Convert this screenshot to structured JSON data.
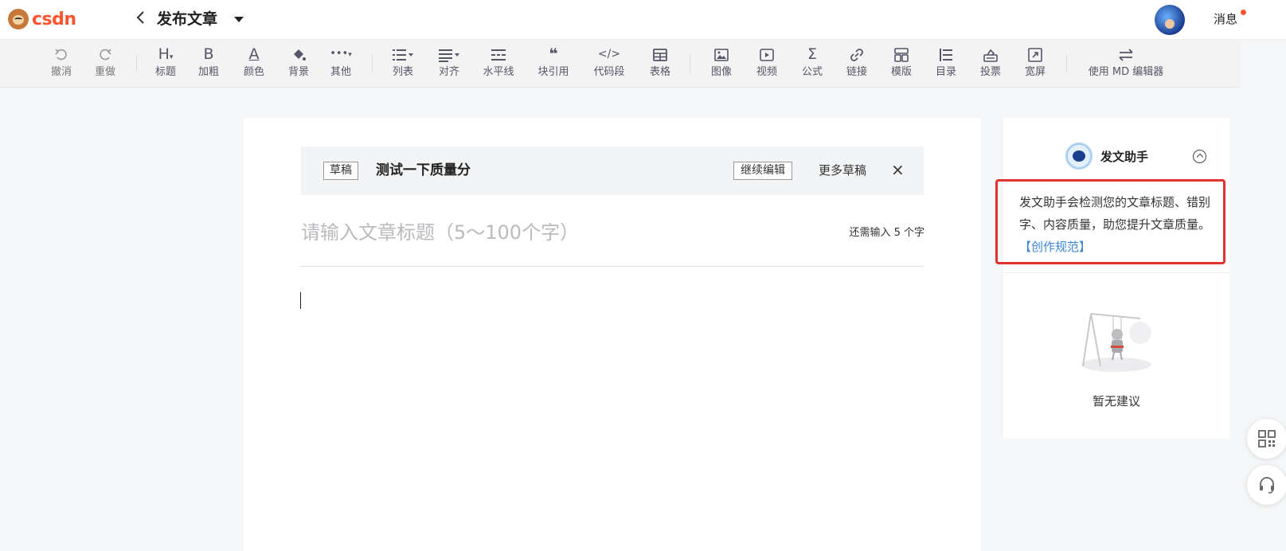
{
  "header": {
    "logo_text": "csdn",
    "back_label": "<",
    "page_title": "发布文章",
    "messages_label": "消息"
  },
  "toolbar": {
    "items": [
      {
        "label": "撤消",
        "icon": "undo-icon"
      },
      {
        "label": "重做",
        "icon": "redo-icon"
      },
      {
        "label": "标题",
        "icon": "heading-icon"
      },
      {
        "label": "加粗",
        "icon": "bold-icon"
      },
      {
        "label": "颜色",
        "icon": "font-color-icon"
      },
      {
        "label": "背景",
        "icon": "paint-bucket-icon"
      },
      {
        "label": "其他",
        "icon": "more-icon"
      },
      {
        "label": "列表",
        "icon": "list-icon"
      },
      {
        "label": "对齐",
        "icon": "align-icon"
      },
      {
        "label": "水平线",
        "icon": "horizontal-rule-icon"
      },
      {
        "label": "块引用",
        "icon": "quote-icon"
      },
      {
        "label": "代码段",
        "icon": "code-icon"
      },
      {
        "label": "表格",
        "icon": "table-icon"
      },
      {
        "label": "图像",
        "icon": "image-icon"
      },
      {
        "label": "视频",
        "icon": "video-icon"
      },
      {
        "label": "公式",
        "icon": "sigma-icon"
      },
      {
        "label": "链接",
        "icon": "link-icon"
      },
      {
        "label": "模版",
        "icon": "template-icon"
      },
      {
        "label": "目录",
        "icon": "toc-icon"
      },
      {
        "label": "投票",
        "icon": "vote-icon"
      },
      {
        "label": "宽屏",
        "icon": "widescreen-icon"
      },
      {
        "label": "使用 MD 编辑器",
        "icon": "switch-editor-icon"
      }
    ],
    "glyphs": {
      "heading": "H",
      "bold": "B",
      "color": "A",
      "more": "•••",
      "quote": "❝",
      "code": "</>",
      "sigma": "Σ"
    }
  },
  "draft": {
    "tag": "草稿",
    "name": "测试一下质量分",
    "continue_label": "继续编辑",
    "more_label": "更多草稿",
    "close_label": "×"
  },
  "editor": {
    "title_placeholder": "请输入文章标题（5～100个字）",
    "title_value": "",
    "char_hint": "还需输入 5 个字"
  },
  "assistant": {
    "title": "发文助手",
    "description": "发文助手会检测您的文章标题、错别字、内容质量，助您提升文章质量。",
    "link_label": "【创作规范】",
    "empty_text": "暂无建议"
  },
  "colors": {
    "brand": "#fc5531",
    "highlight_border": "#e0322f",
    "link": "#3d86d8"
  }
}
